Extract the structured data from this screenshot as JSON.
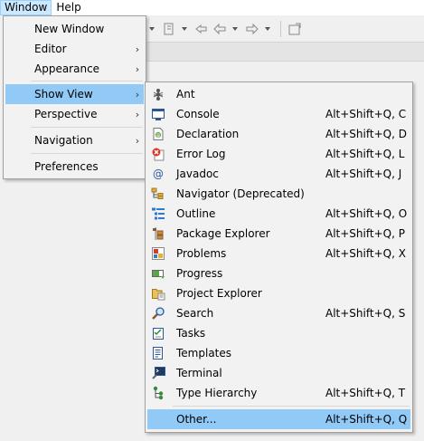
{
  "menubar": {
    "items": [
      {
        "label": "Window"
      },
      {
        "label": "Help"
      }
    ]
  },
  "window_menu": {
    "items": [
      {
        "label": "New Window",
        "submenu": false
      },
      {
        "label": "Editor",
        "submenu": true
      },
      {
        "label": "Appearance",
        "submenu": true
      },
      {
        "label": "Show View",
        "submenu": true,
        "highlighted": true
      },
      {
        "label": "Perspective",
        "submenu": true
      },
      {
        "label": "Navigation",
        "submenu": true
      },
      {
        "label": "Preferences",
        "submenu": false
      }
    ]
  },
  "show_view_menu": {
    "items": [
      {
        "label": "Ant",
        "shortcut": "",
        "icon": "ant-icon"
      },
      {
        "label": "Console",
        "shortcut": "Alt+Shift+Q, C",
        "icon": "console-icon"
      },
      {
        "label": "Declaration",
        "shortcut": "Alt+Shift+Q, D",
        "icon": "declaration-icon"
      },
      {
        "label": "Error Log",
        "shortcut": "Alt+Shift+Q, L",
        "icon": "error-log-icon"
      },
      {
        "label": "Javadoc",
        "shortcut": "Alt+Shift+Q, J",
        "icon": "javadoc-icon"
      },
      {
        "label": "Navigator (Deprecated)",
        "shortcut": "",
        "icon": "navigator-icon"
      },
      {
        "label": "Outline",
        "shortcut": "Alt+Shift+Q, O",
        "icon": "outline-icon"
      },
      {
        "label": "Package Explorer",
        "shortcut": "Alt+Shift+Q, P",
        "icon": "package-explorer-icon"
      },
      {
        "label": "Problems",
        "shortcut": "Alt+Shift+Q, X",
        "icon": "problems-icon"
      },
      {
        "label": "Progress",
        "shortcut": "",
        "icon": "progress-icon"
      },
      {
        "label": "Project Explorer",
        "shortcut": "",
        "icon": "project-explorer-icon"
      },
      {
        "label": "Search",
        "shortcut": "Alt+Shift+Q, S",
        "icon": "search-icon"
      },
      {
        "label": "Tasks",
        "shortcut": "",
        "icon": "tasks-icon"
      },
      {
        "label": "Templates",
        "shortcut": "",
        "icon": "templates-icon"
      },
      {
        "label": "Terminal",
        "shortcut": "",
        "icon": "terminal-icon"
      },
      {
        "label": "Type Hierarchy",
        "shortcut": "Alt+Shift+Q, T",
        "icon": "type-hierarchy-icon"
      }
    ],
    "other": {
      "label": "Other...",
      "shortcut": "Alt+Shift+Q, Q",
      "highlighted": true
    }
  },
  "colors": {
    "highlight": "#91c9f7",
    "menu_bg": "#f2f2f2",
    "menubar_active": "#cce8ff"
  }
}
